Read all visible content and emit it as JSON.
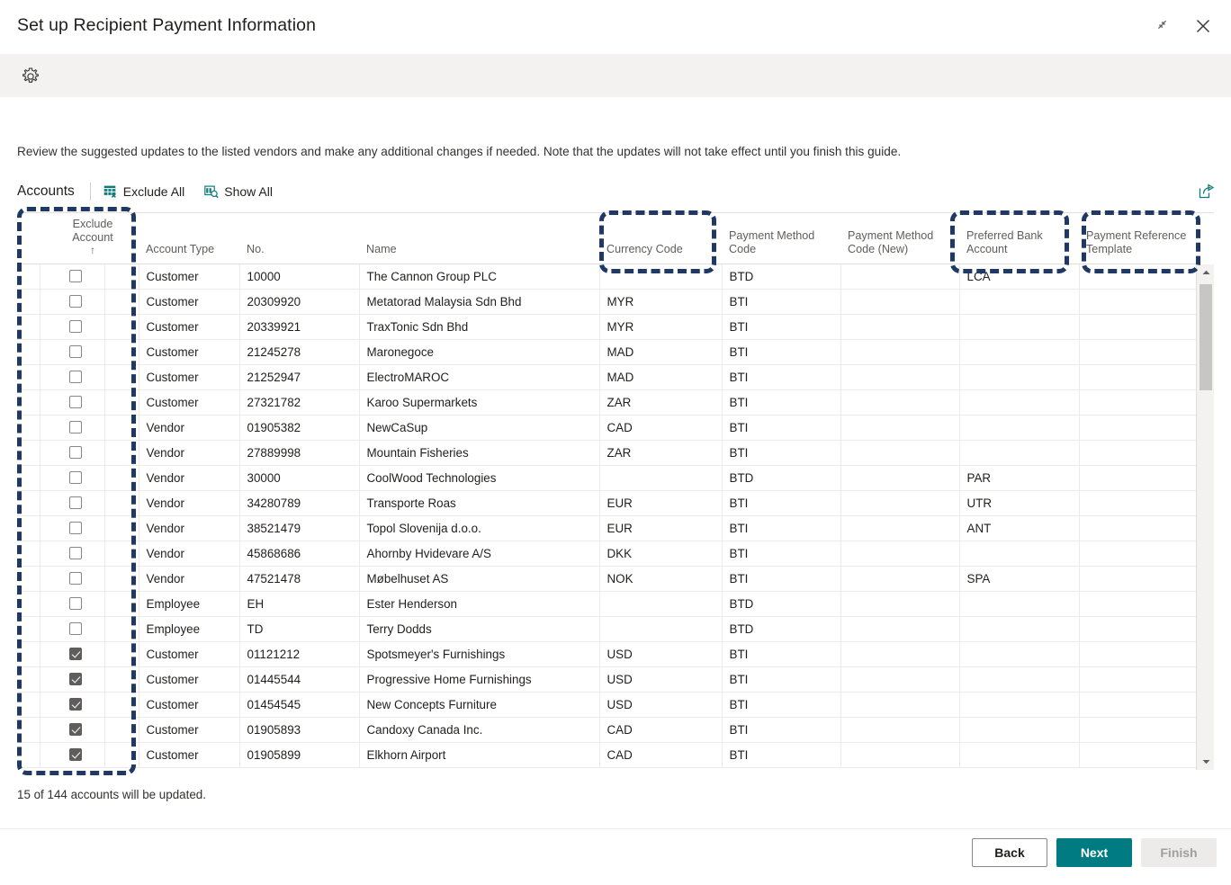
{
  "window": {
    "title": "Set up Recipient Payment Information",
    "restore_icon": "restore-down-icon",
    "close_icon": "close-icon",
    "gear_icon": "gear-icon"
  },
  "intro": "Review the suggested updates to the listed vendors and make any additional changes if needed. Note that the updates will not take effect until you finish this guide.",
  "toolbar": {
    "tab_label": "Accounts",
    "exclude_all_label": "Exclude All",
    "exclude_all_icon": "exclude-grid-icon",
    "show_all_label": "Show All",
    "show_all_icon": "show-all-grid-icon",
    "share_icon": "open-in-new-window-icon"
  },
  "grid": {
    "headers": {
      "exclude_account_line1": "Exclude",
      "exclude_account_line2": "Account",
      "sort_arrow": "↑",
      "account_type": "Account Type",
      "no": "No.",
      "name": "Name",
      "currency_code": "Currency Code",
      "payment_method_code": "Payment Method Code",
      "payment_method_code_new": "Payment Method Code (New)",
      "preferred_bank_account": "Preferred Bank Account",
      "payment_reference_template": "Payment Reference Template"
    },
    "rows": [
      {
        "excluded": false,
        "account_type": "Customer",
        "no": "10000",
        "name": "The Cannon Group PLC",
        "currency_code": "",
        "payment_method_code": "BTD",
        "payment_method_code_new": "",
        "preferred_bank_account": "LCA",
        "payment_reference_template": ""
      },
      {
        "excluded": false,
        "account_type": "Customer",
        "no": "20309920",
        "name": "Metatorad Malaysia Sdn Bhd",
        "currency_code": "MYR",
        "payment_method_code": "BTI",
        "payment_method_code_new": "",
        "preferred_bank_account": "",
        "payment_reference_template": ""
      },
      {
        "excluded": false,
        "account_type": "Customer",
        "no": "20339921",
        "name": "TraxTonic Sdn Bhd",
        "currency_code": "MYR",
        "payment_method_code": "BTI",
        "payment_method_code_new": "",
        "preferred_bank_account": "",
        "payment_reference_template": ""
      },
      {
        "excluded": false,
        "account_type": "Customer",
        "no": "21245278",
        "name": "Maronegoce",
        "currency_code": "MAD",
        "payment_method_code": "BTI",
        "payment_method_code_new": "",
        "preferred_bank_account": "",
        "payment_reference_template": ""
      },
      {
        "excluded": false,
        "account_type": "Customer",
        "no": "21252947",
        "name": "ElectroMAROC",
        "currency_code": "MAD",
        "payment_method_code": "BTI",
        "payment_method_code_new": "",
        "preferred_bank_account": "",
        "payment_reference_template": ""
      },
      {
        "excluded": false,
        "account_type": "Customer",
        "no": "27321782",
        "name": "Karoo Supermarkets",
        "currency_code": "ZAR",
        "payment_method_code": "BTI",
        "payment_method_code_new": "",
        "preferred_bank_account": "",
        "payment_reference_template": ""
      },
      {
        "excluded": false,
        "account_type": "Vendor",
        "no": "01905382",
        "name": "NewCaSup",
        "currency_code": "CAD",
        "payment_method_code": "BTI",
        "payment_method_code_new": "",
        "preferred_bank_account": "",
        "payment_reference_template": ""
      },
      {
        "excluded": false,
        "account_type": "Vendor",
        "no": "27889998",
        "name": "Mountain Fisheries",
        "currency_code": "ZAR",
        "payment_method_code": "BTI",
        "payment_method_code_new": "",
        "preferred_bank_account": "",
        "payment_reference_template": ""
      },
      {
        "excluded": false,
        "account_type": "Vendor",
        "no": "30000",
        "name": "CoolWood Technologies",
        "currency_code": "",
        "payment_method_code": "BTD",
        "payment_method_code_new": "",
        "preferred_bank_account": "PAR",
        "payment_reference_template": ""
      },
      {
        "excluded": false,
        "account_type": "Vendor",
        "no": "34280789",
        "name": "Transporte Roas",
        "currency_code": "EUR",
        "payment_method_code": "BTI",
        "payment_method_code_new": "",
        "preferred_bank_account": "UTR",
        "payment_reference_template": ""
      },
      {
        "excluded": false,
        "account_type": "Vendor",
        "no": "38521479",
        "name": "Topol Slovenija d.o.o.",
        "currency_code": "EUR",
        "payment_method_code": "BTI",
        "payment_method_code_new": "",
        "preferred_bank_account": "ANT",
        "payment_reference_template": ""
      },
      {
        "excluded": false,
        "account_type": "Vendor",
        "no": "45868686",
        "name": "Ahornby Hvidevare A/S",
        "currency_code": "DKK",
        "payment_method_code": "BTI",
        "payment_method_code_new": "",
        "preferred_bank_account": "",
        "payment_reference_template": ""
      },
      {
        "excluded": false,
        "account_type": "Vendor",
        "no": "47521478",
        "name": "Møbelhuset AS",
        "currency_code": "NOK",
        "payment_method_code": "BTI",
        "payment_method_code_new": "",
        "preferred_bank_account": "SPA",
        "payment_reference_template": ""
      },
      {
        "excluded": false,
        "account_type": "Employee",
        "no": "EH",
        "name": "Ester Henderson",
        "currency_code": "",
        "payment_method_code": "BTD",
        "payment_method_code_new": "",
        "preferred_bank_account": "",
        "payment_reference_template": ""
      },
      {
        "excluded": false,
        "account_type": "Employee",
        "no": "TD",
        "name": "Terry Dodds",
        "currency_code": "",
        "payment_method_code": "BTD",
        "payment_method_code_new": "",
        "preferred_bank_account": "",
        "payment_reference_template": ""
      },
      {
        "excluded": true,
        "account_type": "Customer",
        "no": "01121212",
        "name": "Spotsmeyer's Furnishings",
        "currency_code": "USD",
        "payment_method_code": "BTI",
        "payment_method_code_new": "",
        "preferred_bank_account": "",
        "payment_reference_template": ""
      },
      {
        "excluded": true,
        "account_type": "Customer",
        "no": "01445544",
        "name": "Progressive Home Furnishings",
        "currency_code": "USD",
        "payment_method_code": "BTI",
        "payment_method_code_new": "",
        "preferred_bank_account": "",
        "payment_reference_template": ""
      },
      {
        "excluded": true,
        "account_type": "Customer",
        "no": "01454545",
        "name": "New Concepts Furniture",
        "currency_code": "USD",
        "payment_method_code": "BTI",
        "payment_method_code_new": "",
        "preferred_bank_account": "",
        "payment_reference_template": ""
      },
      {
        "excluded": true,
        "account_type": "Customer",
        "no": "01905893",
        "name": "Candoxy Canada Inc.",
        "currency_code": "CAD",
        "payment_method_code": "BTI",
        "payment_method_code_new": "",
        "preferred_bank_account": "",
        "payment_reference_template": ""
      },
      {
        "excluded": true,
        "account_type": "Customer",
        "no": "01905899",
        "name": "Elkhorn Airport",
        "currency_code": "CAD",
        "payment_method_code": "BTI",
        "payment_method_code_new": "",
        "preferred_bank_account": "",
        "payment_reference_template": ""
      }
    ]
  },
  "status": "15 of 144 accounts will be updated.",
  "footer": {
    "back_label": "Back",
    "next_label": "Next",
    "finish_label": "Finish"
  },
  "colors": {
    "accent_teal": "#007b82",
    "annotation_blue": "#1f3864",
    "header_grey": "#605e5c"
  }
}
